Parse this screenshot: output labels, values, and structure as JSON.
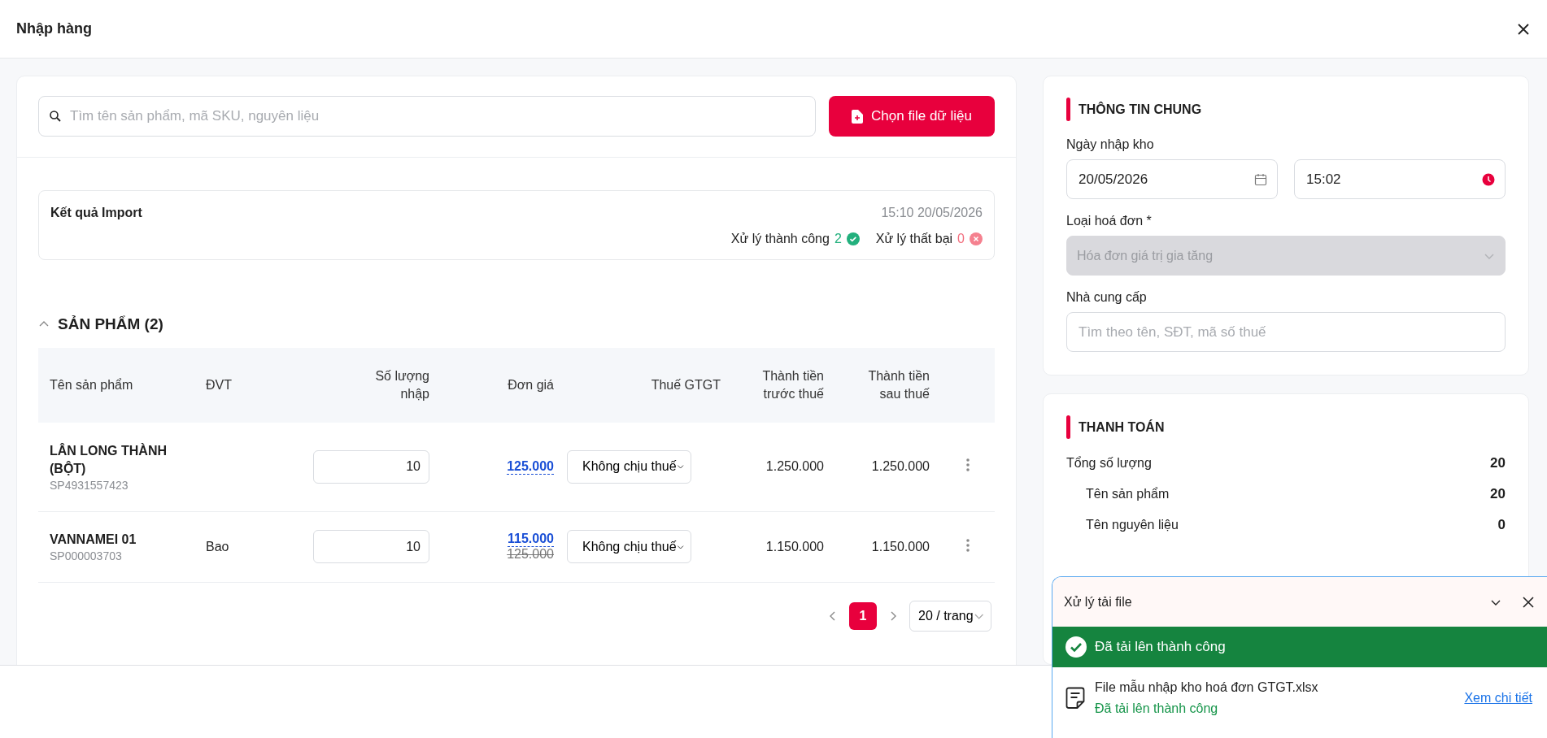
{
  "window": {
    "title": "Nhập hàng"
  },
  "search": {
    "placeholder": "Tìm tên sản phẩm, mã SKU, nguyên liệu"
  },
  "choose_file_button": "Chọn file dữ liệu",
  "import_result": {
    "title": "Kết quả Import",
    "time": "15:10 20/05/2026",
    "success_label": "Xử lý thành công",
    "success_count": "2",
    "failure_label": "Xử lý thất bại",
    "failure_count": "0"
  },
  "products": {
    "title": "SẢN PHẨM (2)",
    "expanded": true,
    "columns": [
      "Tên sản phẩm",
      "ĐVT",
      "Số lượng nhập",
      "Đơn giá",
      "Thuế GTGT",
      "Thành tiền trước thuế",
      "Thành tiền sau thuế"
    ],
    "rows": [
      {
        "name": "LÂN LONG THÀNH (BỘT)",
        "sku": "SP4931557423",
        "quantity": "10",
        "price": "125.000",
        "tax": "Không chịu thuế",
        "before_tax": "1.250.000",
        "after_tax": "1.250.000"
      },
      {
        "name": "VANNAMEI 01",
        "sku": "SP000003703",
        "unit": "Bao",
        "quantity": "10",
        "price": "115.000",
        "old_price": "125.000",
        "tax": "Không chịu thuế",
        "before_tax": "1.150.000",
        "after_tax": "1.150.000"
      }
    ]
  },
  "pagination": {
    "pages": [
      {
        "label": "1",
        "selected": true
      }
    ],
    "page_size": "20 / trang"
  },
  "general_info": {
    "title": "THÔNG TIN CHUNG",
    "date_label": "Ngày nhập kho",
    "date": "20/05/2026",
    "time": "15:02",
    "invoice_label": "Loại hoá đơn *",
    "invoice_type": "Hóa đơn giá trị gia tăng",
    "invoice_disabled": true,
    "supplier_label": "Nhà cung cấp",
    "supplier_placeholder": "Tìm theo tên, SĐT, mã số thuế"
  },
  "payment": {
    "title": "THANH TOÁN",
    "rows": [
      {
        "label": "Tổng số lượng",
        "value": "20",
        "children": [
          {
            "label": "Tên sản phẩm",
            "value": "20"
          },
          {
            "label": "Tên nguyên liệu",
            "value": "0"
          }
        ]
      }
    ]
  },
  "upload_panel": {
    "title": "Xử lý tải file",
    "status": "Đã tải lên thành công",
    "files": [
      {
        "name": "File mẫu nhập kho hoá đơn GTGT.xlsx",
        "status": "Đã tải lên thành công",
        "link": "Xem chi tiết"
      }
    ]
  }
}
